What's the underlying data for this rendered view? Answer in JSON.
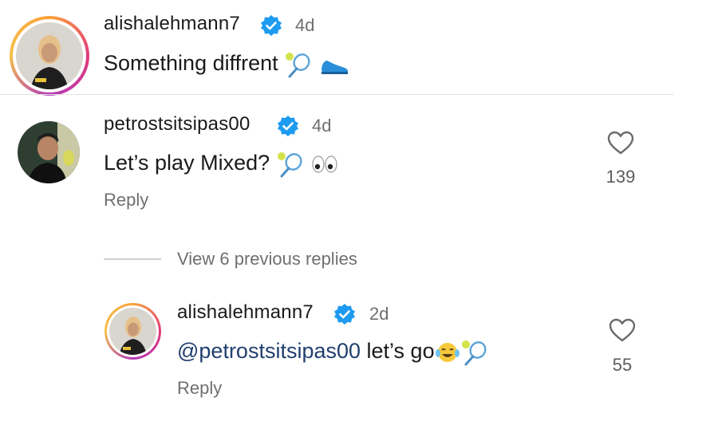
{
  "comments": [
    {
      "username": "alishalehmann7",
      "time": "4d",
      "text": "Something diffrent",
      "emoji": [
        "tennis-racket-icon",
        "sneaker-icon"
      ]
    },
    {
      "username": "petrostsitsipas00",
      "time": "4d",
      "text": "Let’s play Mixed?",
      "emoji": [
        "tennis-racket-icon",
        "eyes-icon"
      ],
      "likes": "139",
      "reply_label": "Reply"
    }
  ],
  "view_replies_label": "View 6 previous replies",
  "reply": {
    "username": "alishalehmann7",
    "time": "2d",
    "mention": "@petrostsitsipas00",
    "text": "let’s go",
    "emoji": [
      "tears-of-joy-icon",
      "tennis-racket-icon"
    ],
    "likes": "55",
    "reply_label": "Reply"
  },
  "colors": {
    "verified": "#1d9bf0",
    "mention": "#21406f",
    "secondary_text": "#6f6f6f"
  }
}
